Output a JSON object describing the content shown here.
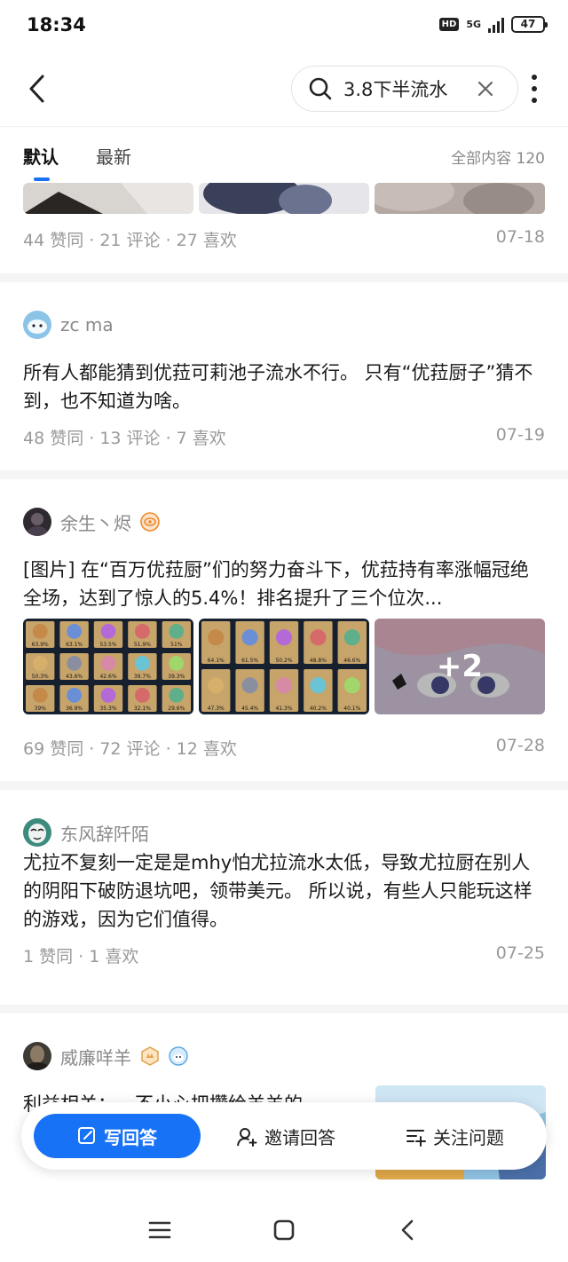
{
  "status_bar": {
    "time": "18:34",
    "hd": "HD",
    "network": "5G",
    "battery": "47"
  },
  "nav": {
    "search_query": "3.8下半流水"
  },
  "tabs": {
    "default_label": "默认",
    "latest_label": "最新",
    "total_label": "全部内容 120",
    "accent": "#1772f6"
  },
  "feed": [
    {
      "stats": "44 赞同 · 21 评论 · 27 喜欢",
      "date": "07-18"
    },
    {
      "author": "zc ma",
      "text": "所有人都能猜到优菈可莉池子流水不行。 只有“优菈厨子”猜不到，也不知道为啥。",
      "stats": "48 赞同 · 13 评论 · 7 喜欢",
      "date": "07-19"
    },
    {
      "author": "余生丶烬",
      "text": "[图片] 在“百万优菈厨”们的努力奋斗下，优菈持有率涨幅冠绝全场，达到了惊人的5.4%！排名提升了三个位次...",
      "grid1": [
        "63.9%",
        "63.1%",
        "53.5%",
        "51.9%",
        "51%",
        "50.3%",
        "43.6%",
        "42.6%",
        "39.7%",
        "39.3%",
        "39%",
        "36.9%",
        "35.3%",
        "32.1%",
        "29.6%"
      ],
      "grid2": [
        "64.1%",
        "61.5%",
        "50.2%",
        "48.8%",
        "46.6%",
        "47.3%",
        "45.4%",
        "41.3%",
        "40.2%",
        "40.1%"
      ],
      "more_images": "+2",
      "stats": "69 赞同 · 72 评论 · 12 喜欢",
      "date": "07-28"
    },
    {
      "author": "东风辞阡陌",
      "text": "尤拉不复刻一定是是mhy怕尤拉流水太低，导致尤拉厨在别人的阴阳下破防退坑吧，领带美元。 所以说，有些人只能玩这样的游戏，因为它们值得。",
      "stats": "1 赞同 · 1 喜欢",
      "date": "07-25"
    },
    {
      "author": "威廉咩羊",
      "text": "利益相关：一不小心把攒给羊羊的"
    }
  ],
  "actions": {
    "write": "写回答",
    "invite": "邀请回答",
    "follow": "关注问题"
  },
  "icons": [
    "back-arrow-icon",
    "search-icon",
    "clear-icon",
    "more-icon",
    "pencil-icon",
    "invite-user-icon",
    "follow-list-icon",
    "menu-icon",
    "home-square-icon",
    "back-triangle-icon"
  ]
}
